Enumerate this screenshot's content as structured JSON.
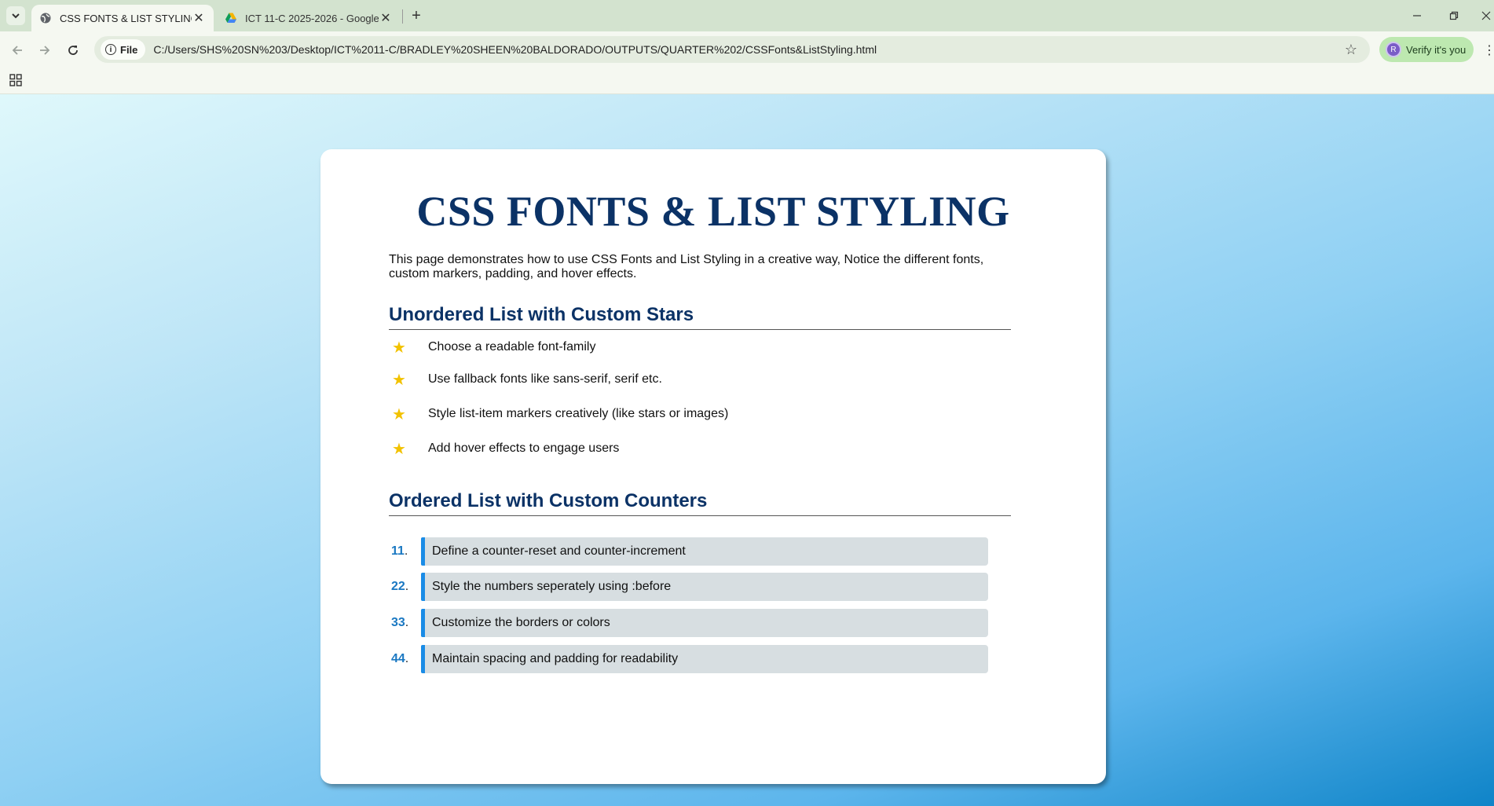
{
  "browser": {
    "tabs": [
      {
        "title": "CSS FONTS & LIST STYLING",
        "active": true
      },
      {
        "title": "ICT 11-C 2025-2026 - Google D",
        "active": false
      }
    ],
    "address": {
      "chip": "File",
      "url": "C:/Users/SHS%20SN%203/Desktop/ICT%2011-C/BRADLEY%20SHEEN%20BALDORADO/OUTPUTS/QUARTER%202/CSSFonts&ListStyling.html"
    },
    "profile": {
      "label": "Verify it's you",
      "initial": "R"
    }
  },
  "page": {
    "title": "CSS FONTS & LIST STYLING",
    "intro": "This page demonstrates how to use CSS Fonts and List Styling in a creative way, Notice the different fonts, custom markers, padding, and hover effects.",
    "unordered": {
      "heading": "Unordered List with Custom Stars",
      "items": [
        "Choose a readable font-family",
        "Use fallback fonts like sans-serif, serif etc.",
        "Style list-item markers creatively (like stars or images)",
        "Add hover effects to engage users"
      ]
    },
    "ordered": {
      "heading": "Ordered List with Custom Counters",
      "items": [
        {
          "number": "11",
          "text": "Define a counter-reset and counter-increment"
        },
        {
          "number": "22",
          "text": "Style the numbers seperately using :before"
        },
        {
          "number": "33",
          "text": "Customize the borders or colors"
        },
        {
          "number": "44",
          "text": "Maintain spacing and padding for readability"
        }
      ]
    }
  },
  "colors": {
    "heading": "#0b3266",
    "star": "#f2c200",
    "counter": "#1a78c2",
    "counter_border": "#1a8ce6",
    "item_bg": "#d7dee1"
  }
}
